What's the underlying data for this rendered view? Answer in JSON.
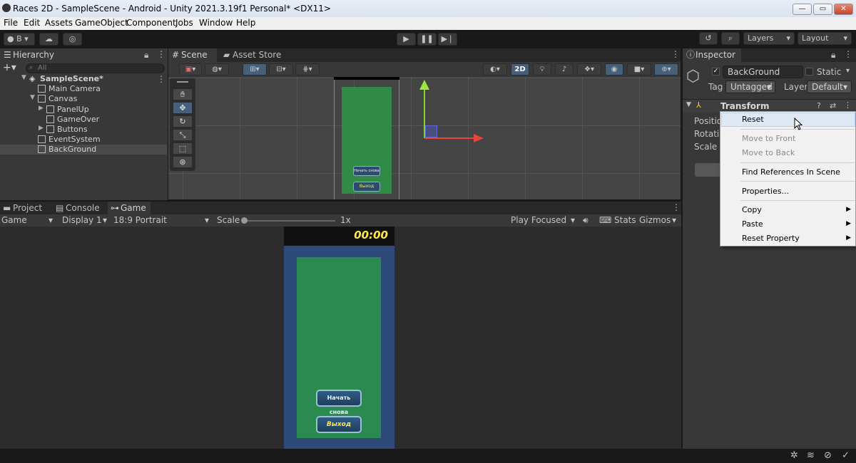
{
  "window": {
    "title": "Races 2D - SampleScene - Android - Unity 2021.3.19f1 Personal* <DX11>",
    "min": "—",
    "max": "▭",
    "close": "✕"
  },
  "menu": [
    "File",
    "Edit",
    "Assets",
    "GameObject",
    "Component",
    "Jobs",
    "Window",
    "Help"
  ],
  "toolbar": {
    "account": "B",
    "layers": "Layers",
    "layout": "Layout"
  },
  "hierarchy": {
    "tab": "Hierarchy",
    "search_placeholder": "All",
    "items": [
      {
        "label": "SampleScene*"
      },
      {
        "label": "Main Camera"
      },
      {
        "label": "Canvas"
      },
      {
        "label": "PanelUp"
      },
      {
        "label": "GameOver"
      },
      {
        "label": "Buttons"
      },
      {
        "label": "EventSystem"
      },
      {
        "label": "BackGround"
      }
    ]
  },
  "scene": {
    "tabs": [
      "Scene",
      "Asset Store"
    ],
    "mode_2d": "2D",
    "btn1": "Начать снова",
    "btn2": "Выход"
  },
  "bottom_tabs": [
    "Project",
    "Console",
    "Game"
  ],
  "game": {
    "display_mode": "Game",
    "display": "Display 1",
    "aspect": "18:9 Portrait",
    "scale_label": "Scale",
    "scale_value": "1x",
    "play_mode": "Play Focused",
    "stats": "Stats",
    "gizmos": "Gizmos",
    "timer": "00:00",
    "btn1": "Начать снова",
    "btn2": "Выход"
  },
  "inspector": {
    "tab": "Inspector",
    "object_name": "BackGround",
    "static": "Static",
    "tag_label": "Tag",
    "tag_value": "Untagged",
    "layer_label": "Layer",
    "layer_value": "Default",
    "component": "Transform",
    "position": "Position",
    "rotation": "Rotation",
    "scale": "Scale"
  },
  "context_menu": {
    "reset": "Reset",
    "move_front": "Move to Front",
    "move_back": "Move to Back",
    "find_refs": "Find References In Scene",
    "properties": "Properties...",
    "copy": "Copy",
    "paste": "Paste",
    "reset_property": "Reset Property"
  },
  "colors": {
    "accent_blue": "#46607c",
    "green_bg": "#2b8a4f",
    "blue_frame": "#2e4a78",
    "timer_yellow": "#ffe94a"
  }
}
